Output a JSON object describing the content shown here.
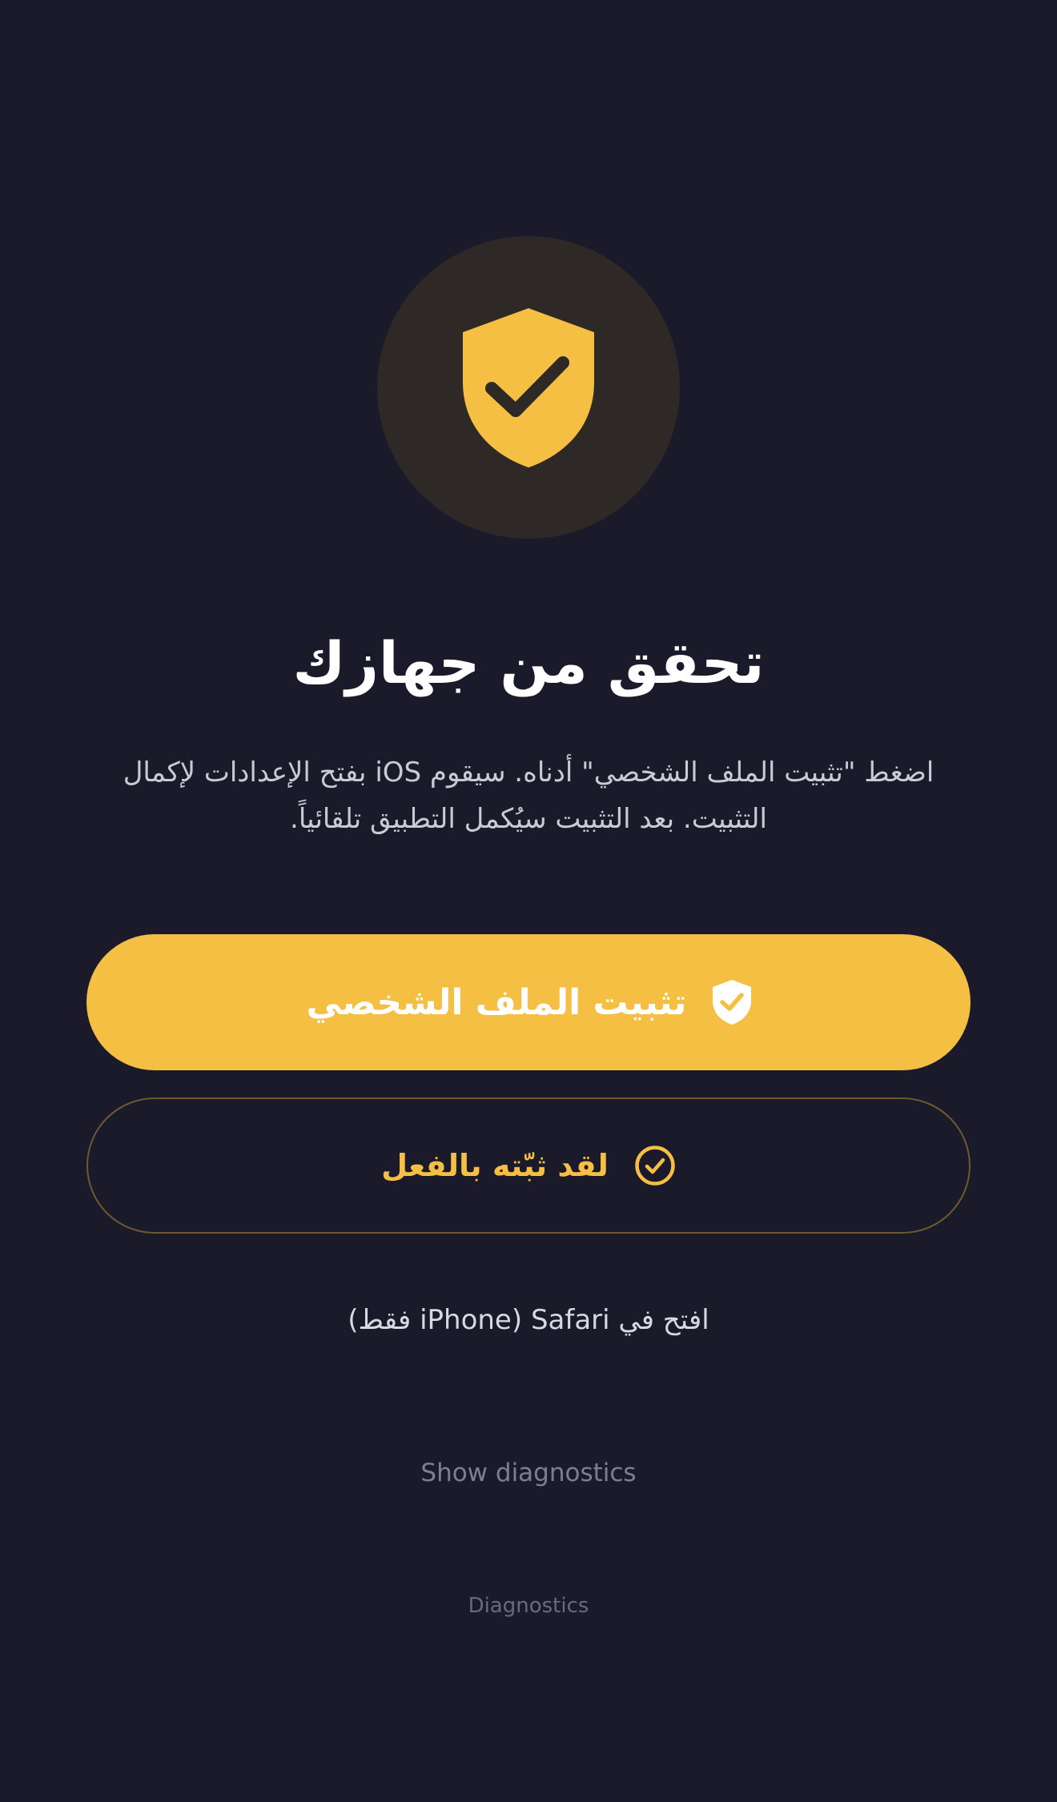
{
  "screen": {
    "title": "تحقق من جهازك",
    "description": "اضغط \"تثبيت الملف الشخصي\" أدناه. سيقوم iOS بفتح الإعدادات لإكمال التثبيت. بعد التثبيت سيُكمل التطبيق تلقائياً.",
    "hero_icon": "shield-check-icon"
  },
  "actions": {
    "install_profile_label": "تثبيت الملف الشخصي",
    "install_profile_icon": "shield-check-icon",
    "already_installed_label": "لقد ثبّته بالفعل",
    "already_installed_icon": "check-circle-icon"
  },
  "hint": {
    "open_in_safari": "افتح في Safari (iPhone فقط)"
  },
  "diagnostics": {
    "toggle_label": "Show diagnostics",
    "footer_label": "Diagnostics"
  },
  "colors": {
    "background": "#1a1a2b",
    "accent": "#f4bf42",
    "hero_circle": "#2e2926",
    "secondary_border": "#6e5a2c",
    "title_text": "#ffffff",
    "body_text": "#c9cad4",
    "muted_text": "#7e7f8e"
  }
}
